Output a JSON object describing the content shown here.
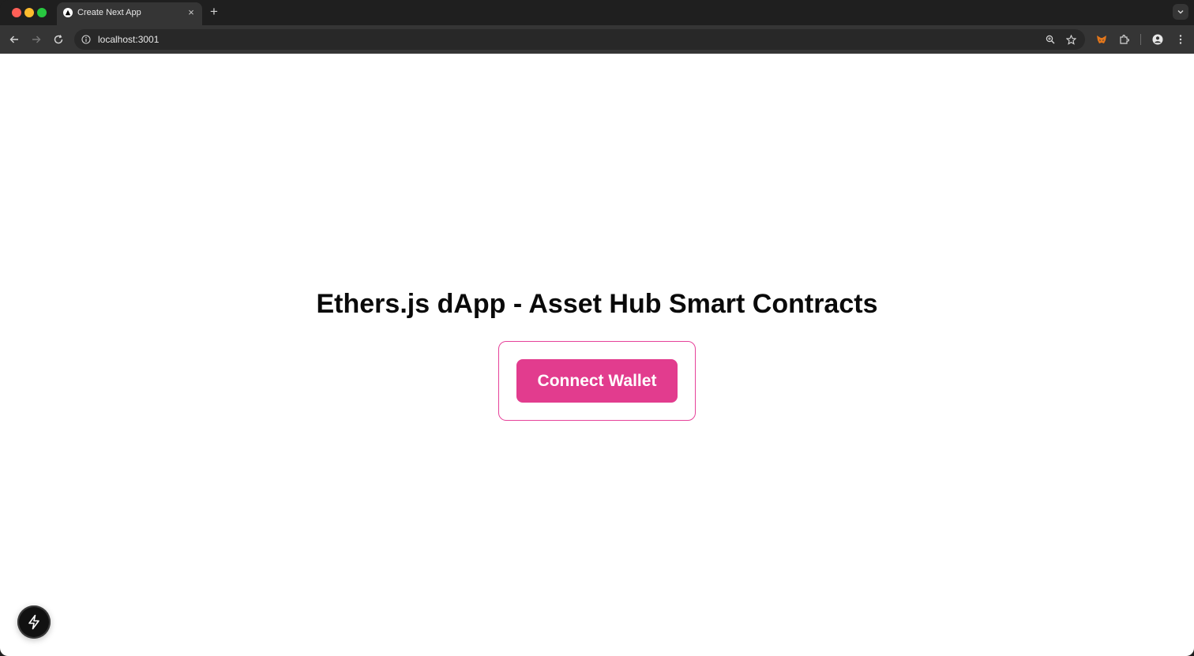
{
  "browser": {
    "tab": {
      "title": "Create Next App",
      "close_label": "×"
    },
    "new_tab_label": "+",
    "address_bar": {
      "url": "localhost:3001"
    },
    "icons": {
      "back": "arrow-left-icon",
      "forward": "arrow-right-icon",
      "reload": "reload-icon",
      "site_info": "info-icon",
      "zoom": "zoom-icon",
      "bookmark": "star-icon",
      "metamask": "metamask-fox-icon",
      "extensions": "puzzle-icon",
      "profile": "person-icon",
      "menu": "kebab-menu-icon",
      "tab_search": "chevron-down-icon"
    }
  },
  "page": {
    "title": "Ethers.js dApp - Asset Hub Smart Contracts",
    "connect_button_label": "Connect Wallet",
    "dev_indicator_icon": "lightning-icon"
  },
  "colors": {
    "accent": "#e23c8e",
    "card_border": "#e6429a",
    "text": "#0a0a0a",
    "browser_frame": "#1f1f1f",
    "toolbar": "#353535"
  }
}
